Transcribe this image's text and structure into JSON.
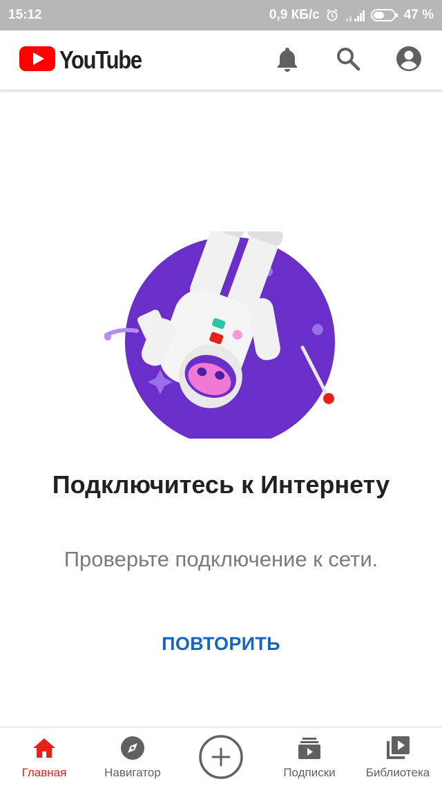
{
  "status_bar": {
    "time": "15:12",
    "network_speed": "0,9 КБ/с",
    "battery": "47 %"
  },
  "header": {
    "app_name": "YouTube",
    "icons": [
      "notifications-bell-icon",
      "search-icon",
      "account-icon"
    ]
  },
  "offline": {
    "title": "Подключитесь к Интернету",
    "subtitle": "Проверьте подключение к сети.",
    "retry_label": "ПОВТОРИТЬ"
  },
  "bottom_nav": {
    "items": [
      {
        "label": "Главная",
        "icon": "home-icon",
        "active": true
      },
      {
        "label": "Навигатор",
        "icon": "explore-compass-icon",
        "active": false
      },
      {
        "label": "",
        "icon": "create-plus-icon",
        "active": false
      },
      {
        "label": "Подписки",
        "icon": "subscriptions-icon",
        "active": false
      },
      {
        "label": "Библиотека",
        "icon": "library-icon",
        "active": false
      }
    ]
  },
  "colors": {
    "brand_red": "#ff0000",
    "active_nav": "#e62117",
    "link_blue": "#1565c0",
    "illustration_purple": "#6a2fc9",
    "status_bar_gray": "#b7b7b7"
  }
}
